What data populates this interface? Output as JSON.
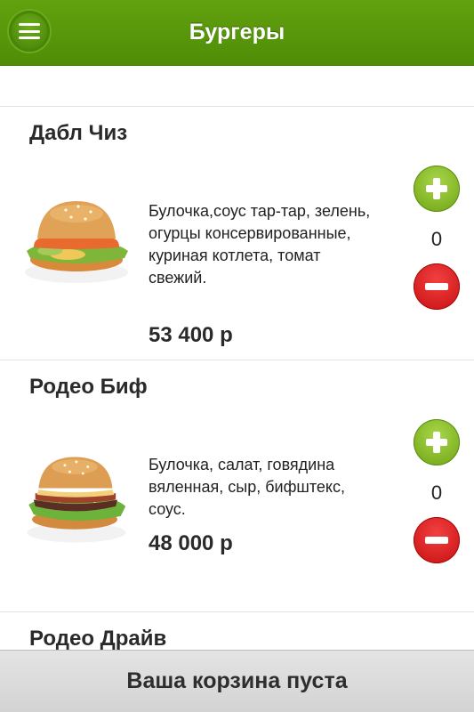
{
  "header": {
    "title": "Бургеры"
  },
  "items": [
    {
      "name": "Дабл Чиз",
      "description": "Булочка,соус тар-тар, зелень, огурцы консервированные, куриная котлета, томат свежий.",
      "price": "53 400 р",
      "quantity": "0"
    },
    {
      "name": "Родео Биф",
      "description": "Булочка, салат, говядина вяленная, сыр, бифштекс, соус.",
      "price": "48 000 р",
      "quantity": "0"
    },
    {
      "name": "Родео Драйв"
    }
  ],
  "cart": {
    "status": "Ваша корзина пуста"
  },
  "colors": {
    "header_green": "#5a9a0c",
    "plus_green": "#8cc22e",
    "minus_red": "#e02020",
    "cart_bar": "#dcdcdc"
  },
  "icons": [
    "menu-icon",
    "plus-icon",
    "minus-icon"
  ]
}
